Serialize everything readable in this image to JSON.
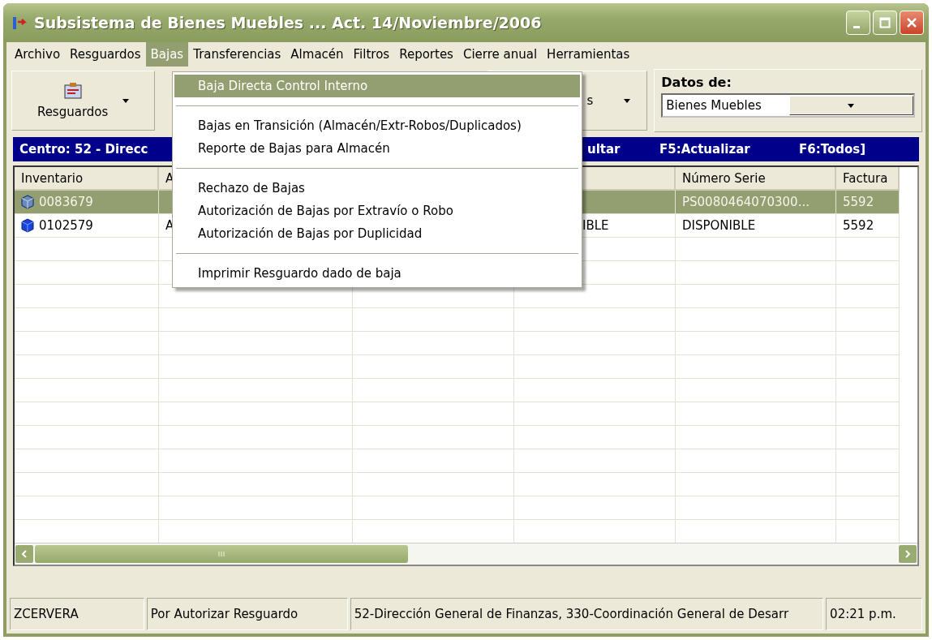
{
  "window": {
    "title": "Subsistema de Bienes Muebles ... Act. 14/Noviembre/2006"
  },
  "menu_bar": [
    {
      "label": "Archivo",
      "selected": false
    },
    {
      "label": "Resguardos",
      "selected": false
    },
    {
      "label": "Bajas",
      "selected": true
    },
    {
      "label": "Transferencias",
      "selected": false
    },
    {
      "label": "Almacén",
      "selected": false
    },
    {
      "label": "Filtros",
      "selected": false
    },
    {
      "label": "Reportes",
      "selected": false
    },
    {
      "label": "Cierre anual",
      "selected": false
    },
    {
      "label": "Herramientas",
      "selected": false
    }
  ],
  "toolbar": {
    "buttons": [
      {
        "label": "Resguardos"
      },
      {
        "label": "s"
      }
    ],
    "datos_de": {
      "label": "Datos de:",
      "value": "Bienes Muebles"
    }
  },
  "info_bar": [
    "Centro: 52 - Direcc",
    "ultar",
    "F5:Actualizar",
    "F6:Todos]"
  ],
  "table": {
    "columns": {
      "column_1": "Inventario",
      "column_2": "A",
      "column_5": "Número Serie",
      "column_6": "Factura"
    },
    "rows": [
      {
        "selected": true,
        "cells": {
          "column_1": "0083679",
          "column_5": "PS0080464070300...",
          "column_6": "5592"
        }
      },
      {
        "selected": false,
        "cells": {
          "column_1": "0102579",
          "column_2": "A",
          "column_4": "IBLE",
          "column_5": "DISPONIBLE",
          "column_6": "5592"
        }
      }
    ]
  },
  "dropdown_menu": [
    {
      "kind": "item",
      "label": "Baja Directa Control Interno",
      "selected": true
    },
    {
      "kind": "separator"
    },
    {
      "kind": "item",
      "label": "Bajas en Transición (Almacén/Extr-Robos/Duplicados)",
      "selected": false
    },
    {
      "kind": "item",
      "label": "Reporte de Bajas para Almacén",
      "selected": false
    },
    {
      "kind": "separator"
    },
    {
      "kind": "item",
      "label": "Rechazo de Bajas",
      "selected": false
    },
    {
      "kind": "item",
      "label": "Autorización de Bajas por Extravío o Robo",
      "selected": false
    },
    {
      "kind": "item",
      "label": "Autorización de Bajas por Duplicidad",
      "selected": false
    },
    {
      "kind": "separator"
    },
    {
      "kind": "item",
      "label": "Imprimir Resguardo dado de baja",
      "selected": false
    }
  ],
  "status_bar": [
    "ZCERVERA",
    "Por Autorizar Resguardo",
    "52-Dirección General de Finanzas, 330-Coordinación General de Desarr",
    "02:21 p.m."
  ]
}
